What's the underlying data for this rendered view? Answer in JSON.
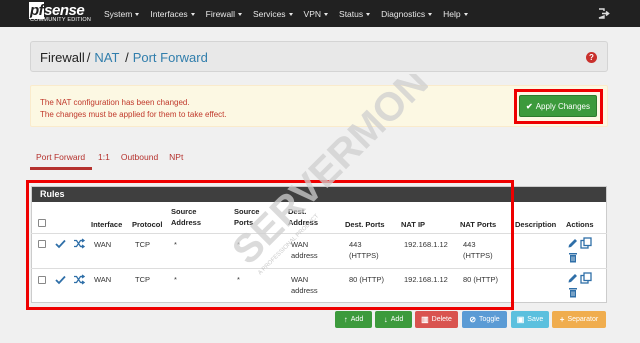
{
  "app": {
    "logo_text": "sense",
    "logo_prefix": "pf",
    "logo_subtitle": "COMMUNITY EDITION"
  },
  "menu": [
    "System",
    "Interfaces",
    "Firewall",
    "Services",
    "VPN",
    "Status",
    "Diagnostics",
    "Help"
  ],
  "breadcrumb": {
    "root": "Firewall",
    "level1": "NAT",
    "level2": "Port Forward"
  },
  "alert": {
    "line1": "The NAT configuration has been changed.",
    "line2": "The changes must be applied for them to take effect.",
    "apply_label": "Apply Changes"
  },
  "tabs": [
    "Port Forward",
    "1:1",
    "Outbound",
    "NPt"
  ],
  "rules_panel": {
    "title": "Rules",
    "columns": {
      "interface": "Interface",
      "protocol": "Protocol",
      "source_address": [
        "Source",
        "Address"
      ],
      "source_ports": [
        "Source",
        "Ports"
      ],
      "dest_address": [
        "Dest.",
        "Address"
      ],
      "dest_ports": "Dest. Ports",
      "nat_ip": "NAT IP",
      "nat_ports": "NAT Ports",
      "description": "Description",
      "actions": "Actions"
    },
    "rows": [
      {
        "interface": "WAN",
        "protocol": "TCP",
        "source_address": "*",
        "source_ports": "*",
        "dest_address": [
          "WAN",
          "address"
        ],
        "dest_ports": [
          "443",
          "(HTTPS)"
        ],
        "nat_ip": "192.168.1.12",
        "nat_ports": [
          "443",
          "(HTTPS)"
        ],
        "description": ""
      },
      {
        "interface": "WAN",
        "protocol": "TCP",
        "source_address": "*",
        "source_ports": "*",
        "dest_address": [
          "WAN",
          "address"
        ],
        "dest_ports": [
          "80 (HTTP)"
        ],
        "nat_ip": "192.168.1.12",
        "nat_ports": [
          "80 (HTTP)"
        ],
        "description": ""
      }
    ]
  },
  "buttons": {
    "add_top": "Add",
    "add_bottom": "Add",
    "delete": "Delete",
    "toggle": "Toggle",
    "save": "Save",
    "separator": "Separator"
  },
  "watermark": {
    "text": "SERVERMON",
    "subtext": "A PROFESSIONAL PRODUCT"
  },
  "colors": {
    "navbar": "#212121",
    "link": "#317eac",
    "alert_text": "#c0392b",
    "success": "#3c9a3c",
    "danger": "#d9534f",
    "info": "#5bc0de",
    "primary": "#3f8fd2",
    "warning": "#f0ad4e",
    "highlight": "#e00000"
  }
}
